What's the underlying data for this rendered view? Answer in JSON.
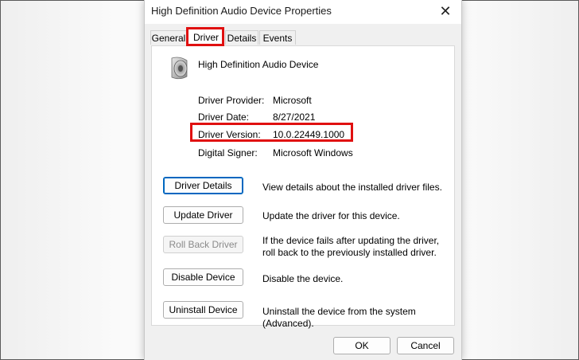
{
  "window": {
    "title": "High Definition Audio Device Properties",
    "close_glyph": "✕"
  },
  "tabs": [
    {
      "label": "General"
    },
    {
      "label": "Driver",
      "active": true
    },
    {
      "label": "Details"
    },
    {
      "label": "Events"
    }
  ],
  "device": {
    "name": "High Definition Audio Device",
    "icon": "speaker-icon"
  },
  "properties": {
    "provider_label": "Driver Provider:",
    "provider_value": "Microsoft",
    "date_label": "Driver Date:",
    "date_value": "8/27/2021",
    "version_label": "Driver Version:",
    "version_value": "10.0.22449.1000",
    "signer_label": "Digital Signer:",
    "signer_value": "Microsoft Windows"
  },
  "actions": {
    "driver_details": {
      "label": "Driver Details",
      "description": "View details about the installed driver files."
    },
    "update_driver": {
      "label": "Update Driver",
      "description": "Update the driver for this device."
    },
    "roll_back": {
      "label": "Roll Back Driver",
      "description": "If the device fails after updating the driver, roll back to the previously installed driver."
    },
    "disable": {
      "label": "Disable Device",
      "description": "Disable the device."
    },
    "uninstall": {
      "label": "Uninstall Device",
      "description": "Uninstall the device from the system (Advanced)."
    }
  },
  "footer": {
    "ok_label": "OK",
    "cancel_label": "Cancel"
  },
  "colors": {
    "highlight": "#e01010",
    "focus": "#0067c0"
  }
}
